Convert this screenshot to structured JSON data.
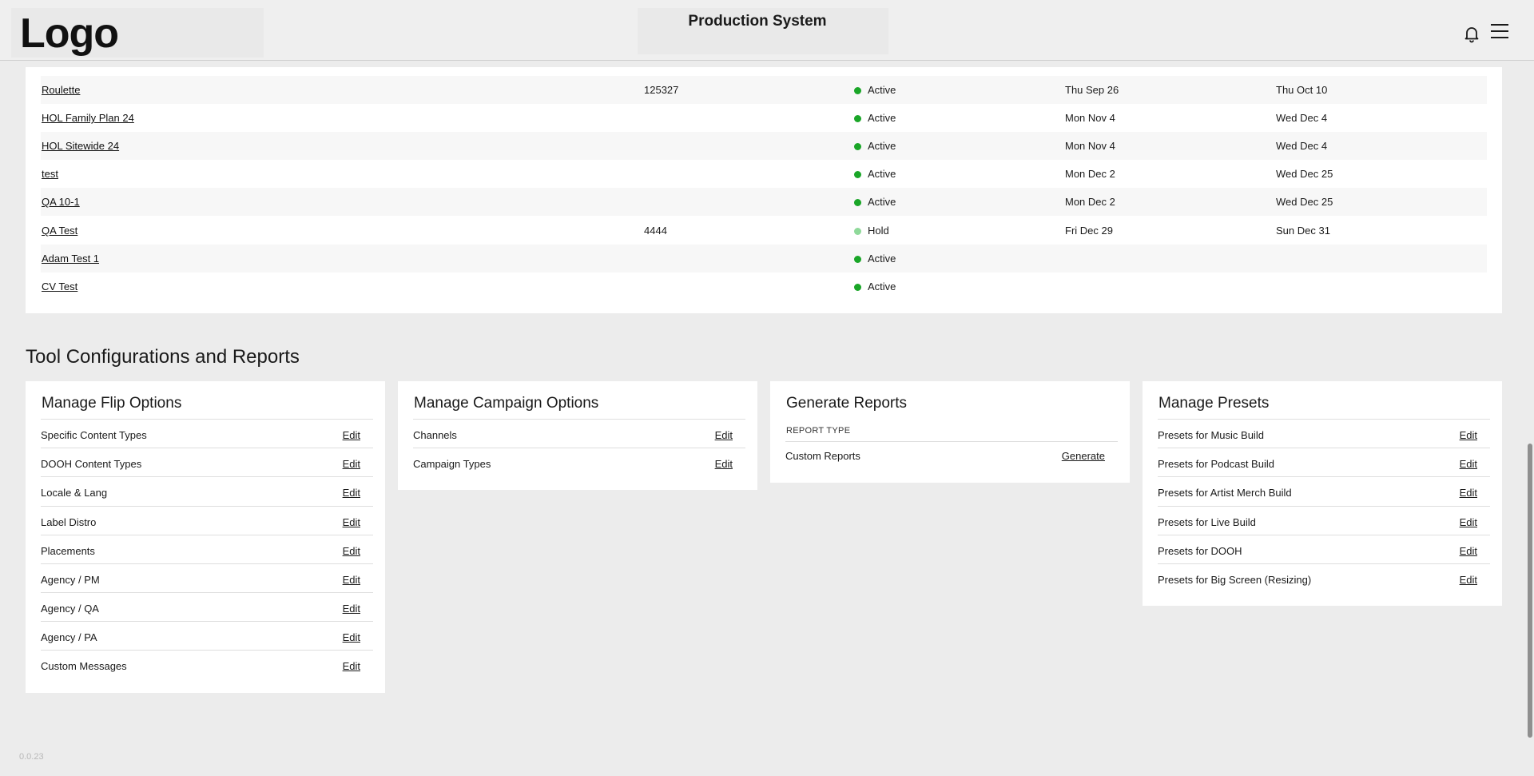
{
  "header": {
    "logo": "Logo",
    "app_title": "Production System"
  },
  "table": {
    "rows": [
      {
        "name": "Roulette",
        "id": "125327",
        "status": "Active",
        "start": "Thu Sep 26",
        "end": "Thu Oct 10"
      },
      {
        "name": "HOL Family Plan 24",
        "id": "",
        "status": "Active",
        "start": "Mon Nov 4",
        "end": "Wed Dec 4"
      },
      {
        "name": "HOL Sitewide 24",
        "id": "",
        "status": "Active",
        "start": "Mon Nov 4",
        "end": "Wed Dec 4"
      },
      {
        "name": "test",
        "id": "",
        "status": "Active",
        "start": "Mon Dec 2",
        "end": "Wed Dec 25"
      },
      {
        "name": "QA 10-1",
        "id": "",
        "status": "Active",
        "start": "Mon Dec 2",
        "end": "Wed Dec 25"
      },
      {
        "name": "QA Test",
        "id": "4444",
        "status": "Hold",
        "start": "Fri Dec 29",
        "end": "Sun Dec 31"
      },
      {
        "name": "Adam Test 1",
        "id": "",
        "status": "Active",
        "start": "",
        "end": ""
      },
      {
        "name": "CV Test",
        "id": "",
        "status": "Active",
        "start": "",
        "end": ""
      }
    ]
  },
  "tools": {
    "section_title": "Tool Configurations and Reports",
    "flip": {
      "title": "Manage Flip Options",
      "items": [
        {
          "label": "Specific Content Types",
          "action": "Edit"
        },
        {
          "label": "DOOH Content Types",
          "action": "Edit"
        },
        {
          "label": "Locale & Lang",
          "action": "Edit"
        },
        {
          "label": "Label Distro",
          "action": "Edit"
        },
        {
          "label": "Placements",
          "action": "Edit"
        },
        {
          "label": "Agency / PM",
          "action": "Edit"
        },
        {
          "label": "Agency / QA",
          "action": "Edit"
        },
        {
          "label": "Agency / PA",
          "action": "Edit"
        },
        {
          "label": "Custom Messages",
          "action": "Edit"
        }
      ]
    },
    "campaign": {
      "title": "Manage Campaign Options",
      "items": [
        {
          "label": "Channels",
          "action": "Edit"
        },
        {
          "label": "Campaign Types",
          "action": "Edit"
        }
      ]
    },
    "reports": {
      "title": "Generate Reports",
      "report_type_label": "REPORT TYPE",
      "items": [
        {
          "label": "Custom Reports",
          "action": "Generate"
        }
      ]
    },
    "presets": {
      "title": "Manage Presets",
      "items": [
        {
          "label": "Presets for Music Build",
          "action": "Edit"
        },
        {
          "label": "Presets for Podcast Build",
          "action": "Edit"
        },
        {
          "label": "Presets for Artist Merch Build",
          "action": "Edit"
        },
        {
          "label": "Presets for Live Build",
          "action": "Edit"
        },
        {
          "label": "Presets for DOOH",
          "action": "Edit"
        },
        {
          "label": "Presets for Big Screen (Resizing)",
          "action": "Edit"
        }
      ]
    }
  },
  "footer": {
    "version": "0.0.23"
  },
  "icons": {
    "bell": "bell-icon",
    "menu": "hamburger-menu-icon"
  },
  "colors": {
    "status_active": "#1aa628",
    "status_hold": "#8fd99a"
  }
}
